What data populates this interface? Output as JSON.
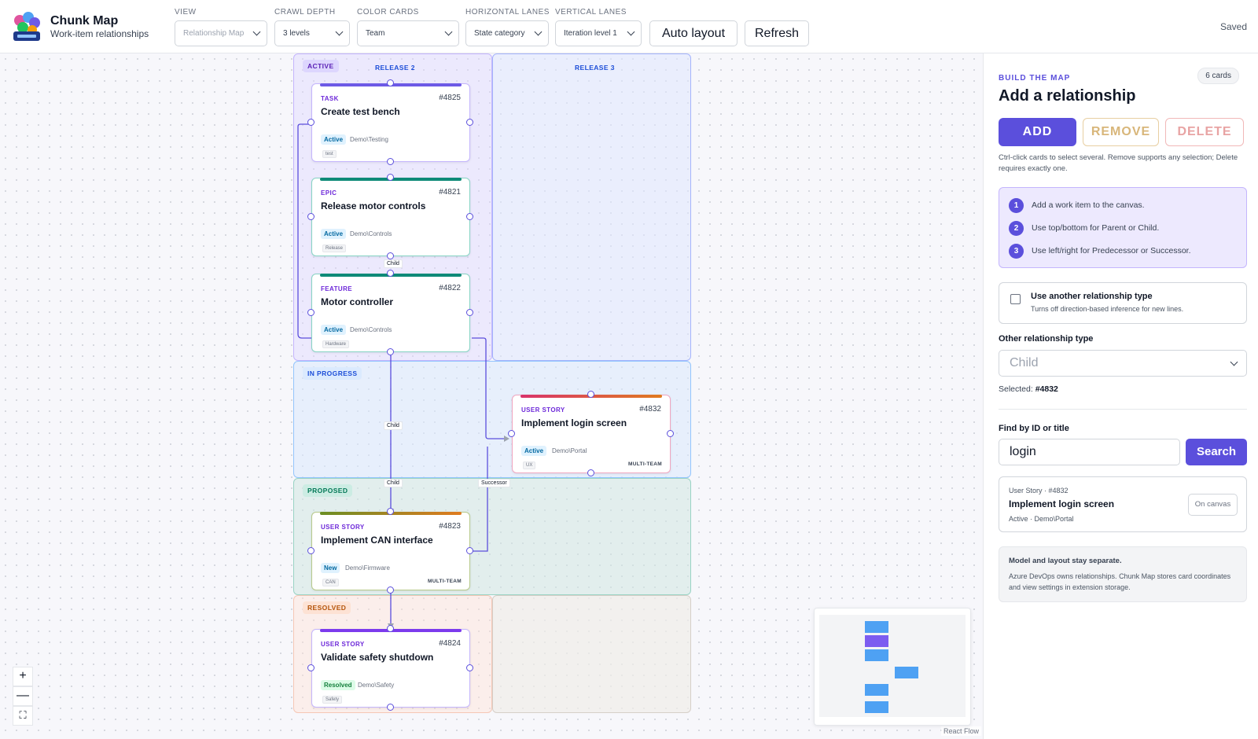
{
  "app": {
    "title": "Chunk Map",
    "subtitle": "Work-item relationships"
  },
  "toolbar": {
    "view": {
      "label": "VIEW",
      "value": "Relationship Map"
    },
    "crawl_depth": {
      "label": "CRAWL DEPTH",
      "value": "3 levels"
    },
    "color_cards": {
      "label": "COLOR CARDS",
      "value": "Team"
    },
    "horizontal_lanes": {
      "label": "HORIZONTAL LANES",
      "value": "State category"
    },
    "vertical_lanes": {
      "label": "VERTICAL LANES",
      "value": "Iteration level 1"
    },
    "auto_layout": "Auto layout",
    "refresh": "Refresh",
    "status": "Saved"
  },
  "lanes": {
    "rows": [
      {
        "label": "ACTIVE",
        "color": "#6d28d9"
      },
      {
        "label": "IN PROGRESS",
        "color": "#1d4ed8"
      },
      {
        "label": "PROPOSED",
        "color": "#047857"
      },
      {
        "label": "RESOLVED",
        "color": "#b45309"
      }
    ],
    "columns": [
      "RELEASE 2",
      "RELEASE 3"
    ]
  },
  "cards": [
    {
      "type": "TASK",
      "id": "#4825",
      "title": "Create test bench",
      "state": "Active",
      "area": "Demo\\Testing",
      "tag": "test",
      "multi": "",
      "strip": "#6d5ae6"
    },
    {
      "type": "EPIC",
      "id": "#4821",
      "title": "Release motor controls",
      "state": "Active",
      "area": "Demo\\Controls",
      "tag": "Release",
      "multi": "",
      "strip": "#0f8a78"
    },
    {
      "type": "FEATURE",
      "id": "#4822",
      "title": "Motor controller",
      "state": "Active",
      "area": "Demo\\Controls",
      "tag": "Hardware",
      "multi": "",
      "strip": "#0f8a78"
    },
    {
      "type": "USER STORY",
      "id": "#4832",
      "title": "Implement login screen",
      "state": "Active",
      "area": "Demo\\Portal",
      "tag": "UX",
      "multi": "MULTI-TEAM",
      "strip": "#d9346b"
    },
    {
      "type": "USER STORY",
      "id": "#4823",
      "title": "Implement CAN interface",
      "state": "New",
      "area": "Demo\\Firmware",
      "tag": "CAN",
      "multi": "MULTI-TEAM",
      "strip": "#6b8e23"
    },
    {
      "type": "USER STORY",
      "id": "#4824",
      "title": "Validate safety shutdown",
      "state": "Resolved",
      "area": "Demo\\Safety",
      "tag": "Safety",
      "multi": "",
      "strip": "#7c3aed"
    }
  ],
  "edges": {
    "child_1": "Child",
    "child_2": "Child",
    "child_3": "Child",
    "successor": "Successor"
  },
  "zoom": {
    "in": "+",
    "out": "—",
    "fit": "⛶"
  },
  "attribution": "React Flow",
  "panel": {
    "eyebrow": "BUILD THE MAP",
    "count": "6 cards",
    "title": "Add a relationship",
    "add": "ADD",
    "remove": "REMOVE",
    "delete": "DELETE",
    "hint": "Ctrl-click cards to select several. Remove supports any selection; Delete requires exactly one.",
    "steps": [
      {
        "n": "1",
        "text": "Add a work item to the canvas."
      },
      {
        "n": "2",
        "text": "Use top/bottom for Parent or Child."
      },
      {
        "n": "3",
        "text": "Use left/right for Predecessor or Successor."
      }
    ],
    "option": {
      "title": "Use another relationship type",
      "sub": "Turns off direction-based inference for new lines."
    },
    "other_label": "Other relationship type",
    "other_value": "Child",
    "selected_label": "Selected:",
    "selected_value": "#4832",
    "find_label": "Find by ID or title",
    "find_value": "login",
    "search": "Search",
    "result": {
      "meta": "User Story · #4832",
      "title": "Implement login screen",
      "sub": "Active · Demo\\Portal",
      "button": "On canvas"
    },
    "note": {
      "title": "Model and layout stay separate.",
      "body": "Azure DevOps owns relationships. Chunk Map stores card coordinates and view settings in extension storage."
    }
  }
}
